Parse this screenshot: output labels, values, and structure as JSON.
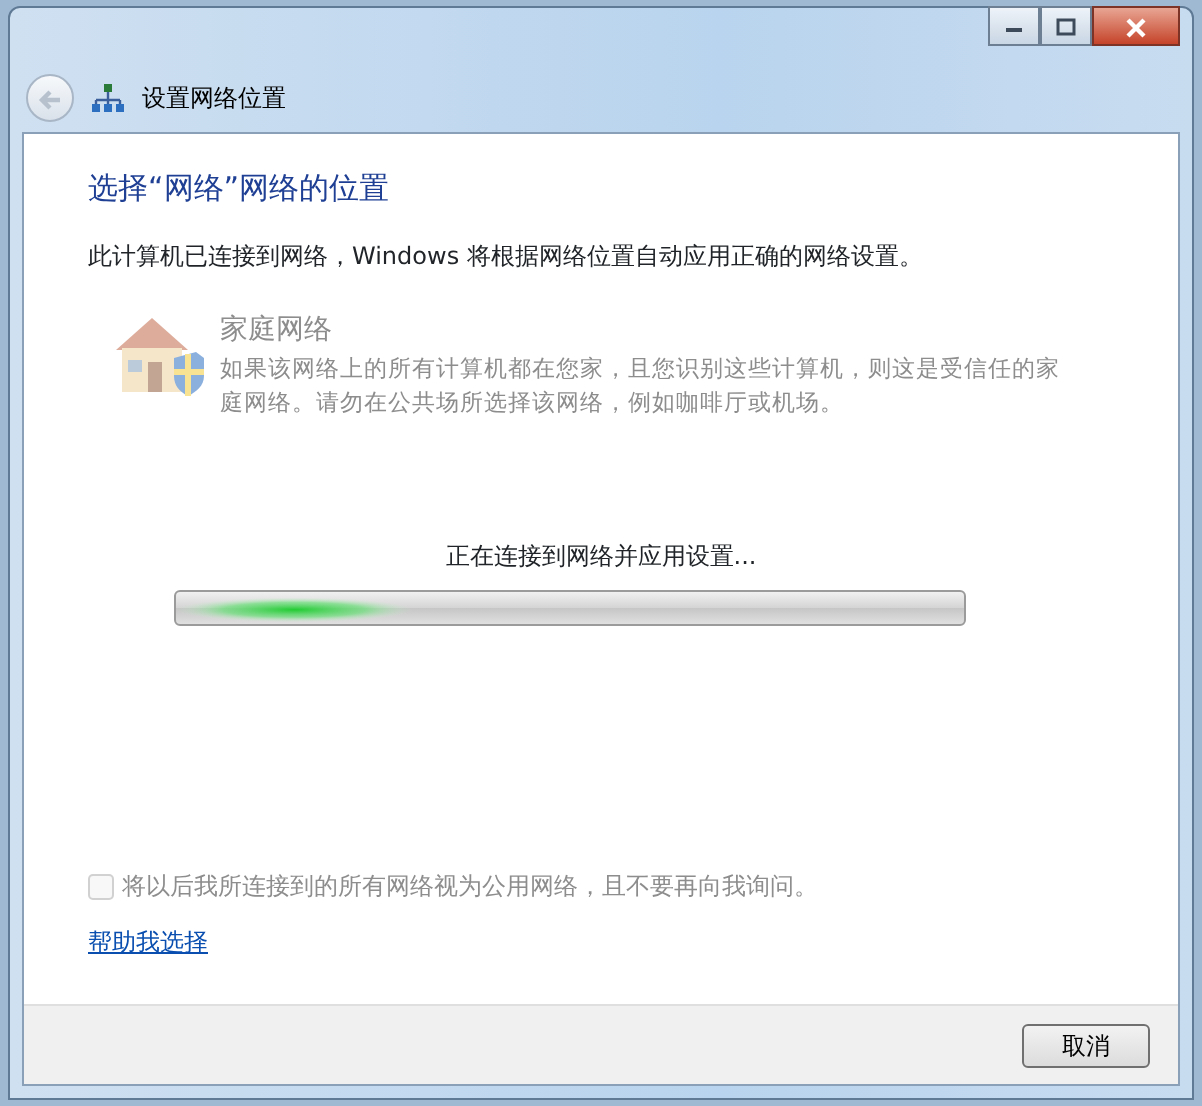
{
  "window": {
    "title": "设置网络位置"
  },
  "heading": "选择“网络”网络的位置",
  "intro": "此计算机已连接到网络，Windows 将根据网络位置自动应用正确的网络设置。",
  "option": {
    "title": "家庭网络",
    "description": "如果该网络上的所有计算机都在您家，且您识别这些计算机，则这是受信任的家庭网络。请勿在公共场所选择该网络，例如咖啡厅或机场。",
    "disabled": true
  },
  "progress": {
    "label": "正在连接到网络并应用设置...",
    "level": 0.3
  },
  "checkbox": {
    "label": "将以后我所连接到的所有网络视为公用网络，且不要再向我询问。",
    "checked": false,
    "disabled": true
  },
  "help_link": "帮助我选择",
  "buttons": [
    "取消"
  ]
}
